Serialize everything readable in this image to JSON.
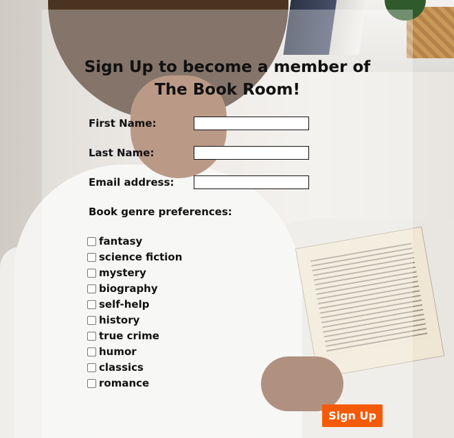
{
  "form": {
    "title_line1": "Sign Up to become a member of",
    "title_line2": "The Book Room!",
    "first_name_label": "First Name:",
    "first_name_value": "",
    "last_name_label": "Last Name:",
    "last_name_value": "",
    "email_label": "Email address:",
    "email_value": "",
    "genre_label": "Book genre preferences:",
    "genres": [
      "fantasy",
      "science fiction",
      "mystery",
      "biography",
      "self-help",
      "history",
      "true crime",
      "humor",
      "classics",
      "romance"
    ],
    "submit_label": "Sign Up"
  },
  "colors": {
    "button": "#f55b06",
    "text": "#111111"
  }
}
